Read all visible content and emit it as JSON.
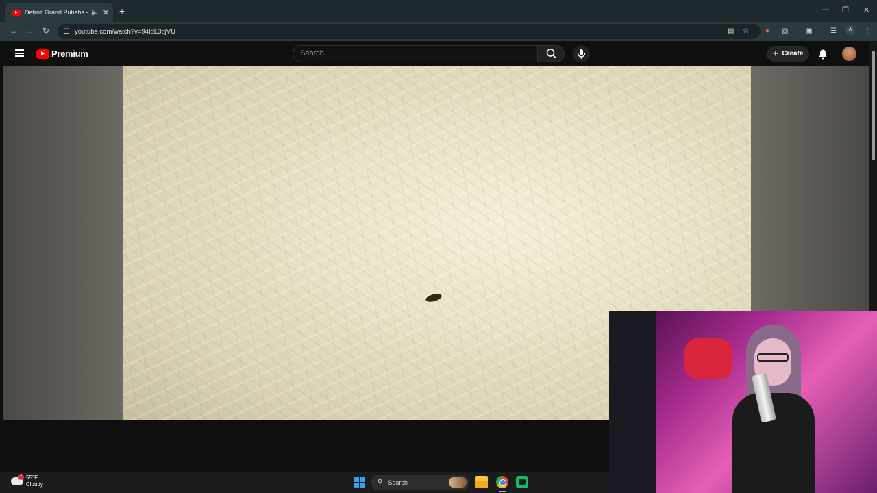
{
  "browser": {
    "tab": {
      "title": "Detroit Grand Pubahs - San",
      "audio_icon": "speaker-icon",
      "close_label": "✕"
    },
    "new_tab_label": "+",
    "window_controls": {
      "minimize": "—",
      "maximize": "❐",
      "close": "✕"
    },
    "nav": {
      "back": "←",
      "forward": "→",
      "reload": "↻"
    },
    "url": "youtube.com/watch?v=94IdL3djVU",
    "site_info_icon": "tune-icon",
    "toolbar_icons": [
      "install-icon",
      "star-icon",
      "extension-orange-icon",
      "puzzle-icon",
      "split-icon",
      "media-icon"
    ],
    "profile_initial": "A",
    "menu_label": "⋮"
  },
  "youtube": {
    "brand": "Premium",
    "search": {
      "placeholder": "Search"
    },
    "create_label": "Create",
    "icons": [
      "menu-icon",
      "search-icon",
      "mic-icon",
      "bell-icon",
      "avatar"
    ]
  },
  "taskbar": {
    "weather": {
      "temperature": "55°F",
      "condition": "Cloudy",
      "badge": "2"
    },
    "search_label": "Search",
    "apps": [
      "windows-start-icon",
      "file-explorer-icon",
      "chrome-icon",
      "obs-icon"
    ]
  }
}
